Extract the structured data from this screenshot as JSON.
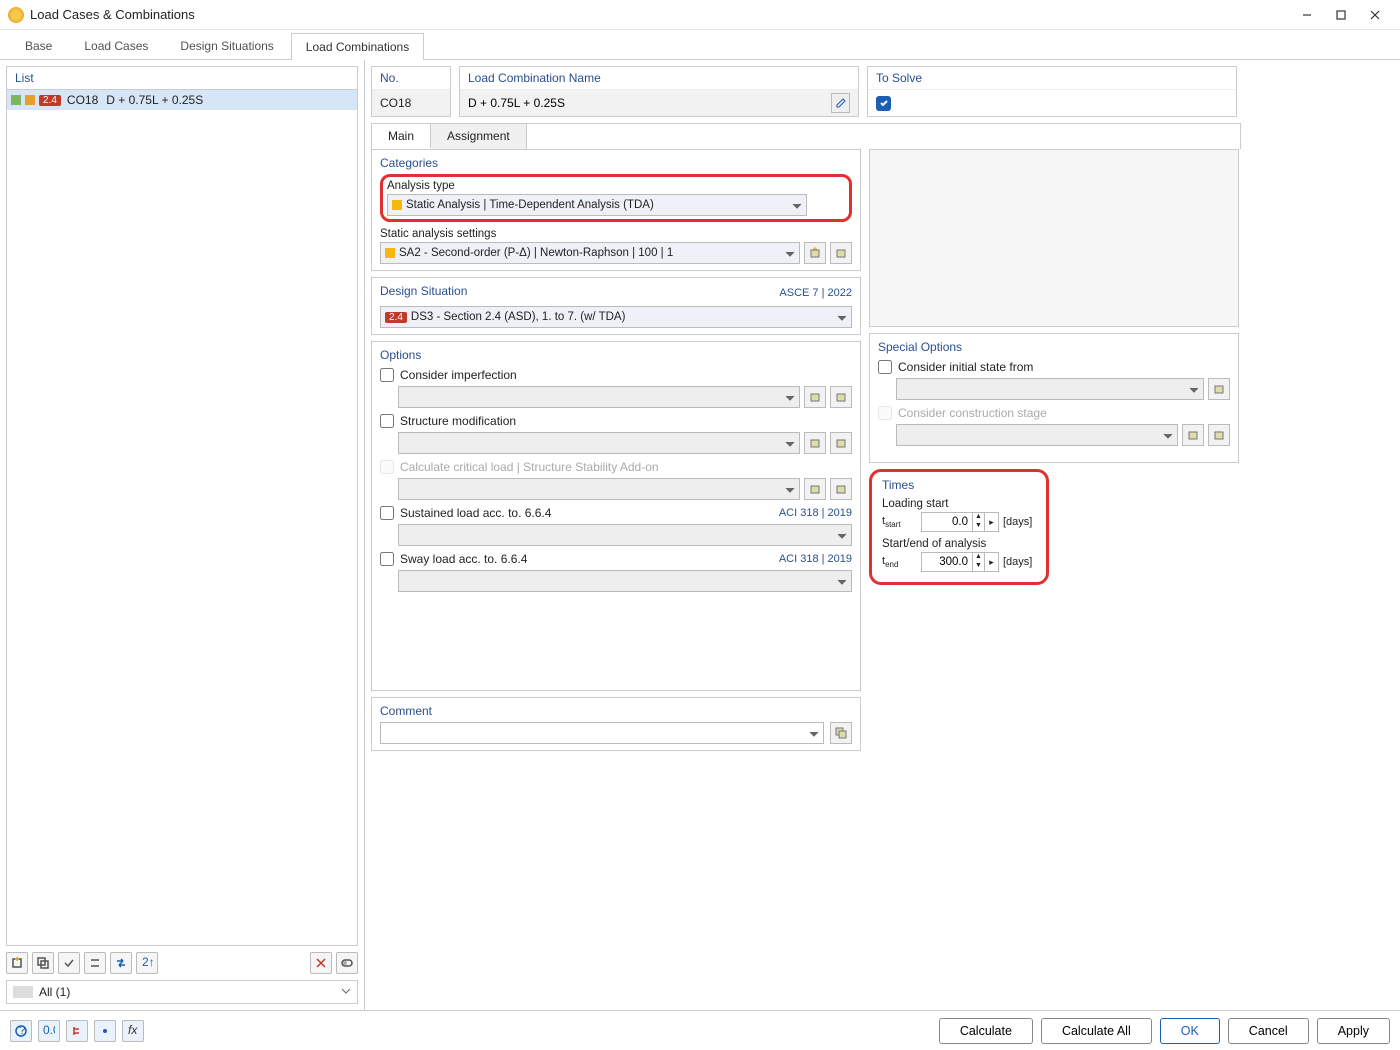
{
  "window": {
    "title": "Load Cases & Combinations"
  },
  "main_tabs": {
    "base": "Base",
    "load_cases": "Load Cases",
    "design_situations": "Design Situations",
    "load_combinations": "Load Combinations"
  },
  "list": {
    "label": "List",
    "items": [
      {
        "badge": "2.4",
        "code": "CO18",
        "name": "D + 0.75L + 0.25S"
      }
    ],
    "filter": "All (1)"
  },
  "top": {
    "no_label": "No.",
    "no_value": "CO18",
    "name_label": "Load Combination Name",
    "name_value": "D + 0.75L + 0.25S",
    "solve_label": "To Solve"
  },
  "subtabs": {
    "main": "Main",
    "assignment": "Assignment"
  },
  "categories": {
    "title": "Categories",
    "analysis_type_label": "Analysis type",
    "analysis_type_value": "Static Analysis | Time-Dependent Analysis (TDA)",
    "static_settings_label": "Static analysis settings",
    "static_settings_value": "SA2 - Second-order (P-Δ) | Newton-Raphson | 100 | 1"
  },
  "design_situation": {
    "title": "Design Situation",
    "code": "ASCE 7 | 2022",
    "badge": "2.4",
    "value": "DS3 - Section 2.4 (ASD), 1. to 7. (w/ TDA)"
  },
  "options": {
    "title": "Options",
    "consider_imperfection": "Consider imperfection",
    "structure_modification": "Structure modification",
    "calc_critical": "Calculate critical load | Structure Stability Add-on",
    "sustained": "Sustained load acc. to. 6.6.4",
    "sustained_code": "ACI 318 | 2019",
    "sway": "Sway load acc. to. 6.6.4",
    "sway_code": "ACI 318 | 2019"
  },
  "special": {
    "title": "Special Options",
    "initial_state": "Consider initial state from",
    "construction_stage": "Consider construction stage"
  },
  "times": {
    "title": "Times",
    "loading_start_label": "Loading start",
    "t_start_sym": "tstart",
    "t_start_val": "0.0",
    "unit": "[days]",
    "startend_label": "Start/end of analysis",
    "t_end_sym": "tend",
    "t_end_val": "300.0"
  },
  "comment": {
    "label": "Comment",
    "value": ""
  },
  "footer": {
    "calculate": "Calculate",
    "calculate_all": "Calculate All",
    "ok": "OK",
    "cancel": "Cancel",
    "apply": "Apply"
  }
}
